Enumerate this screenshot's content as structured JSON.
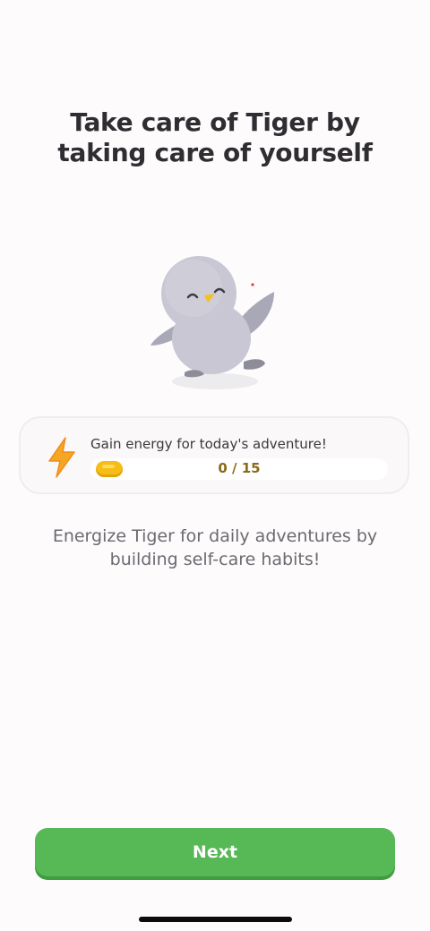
{
  "header": {
    "title": "Take care of Tiger by taking care of yourself"
  },
  "mascot": {
    "icon": "penguin-mascot-icon"
  },
  "energy_card": {
    "icon": "lightning-bolt-icon",
    "label": "Gain energy for today's adventure!",
    "progress_text": "0 / 15",
    "progress_current": 0,
    "progress_total": 15,
    "token_icon": "energy-token-icon"
  },
  "description": "Energize Tiger for daily adventures by building self-care habits!",
  "footer": {
    "next_label": "Next"
  },
  "colors": {
    "primary_button": "#57b856",
    "energy_yellow": "#f6bd16",
    "bolt_orange": "#f5a623"
  }
}
